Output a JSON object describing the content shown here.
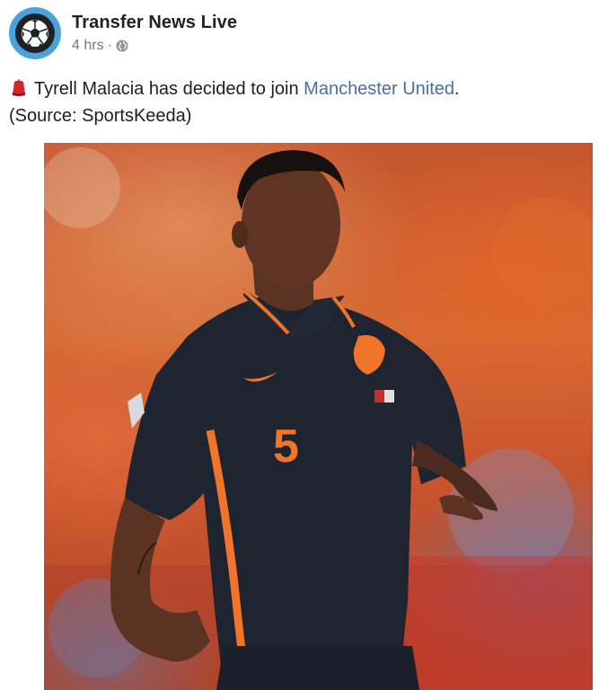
{
  "post": {
    "page_name": "Transfer News Live",
    "time": "4 hrs",
    "separator": "·",
    "privacy_icon": "globe-icon",
    "avatar_icon": "soccer-ball-icon",
    "text_line1_prefix": "Tyrell Malacia has decided to join ",
    "text_link": "Manchester United",
    "text_line1_suffix": ".",
    "text_line2": "(Source: SportsKeeda)",
    "emoji": "red-hat-emoji",
    "photo_icon": "player-photo",
    "jersey_number": "5"
  },
  "colors": {
    "avatar_ring": "#4aa3df",
    "link": "#4c6d9a",
    "jersey": "#1e2430",
    "jersey_accent": "#f0752a"
  }
}
